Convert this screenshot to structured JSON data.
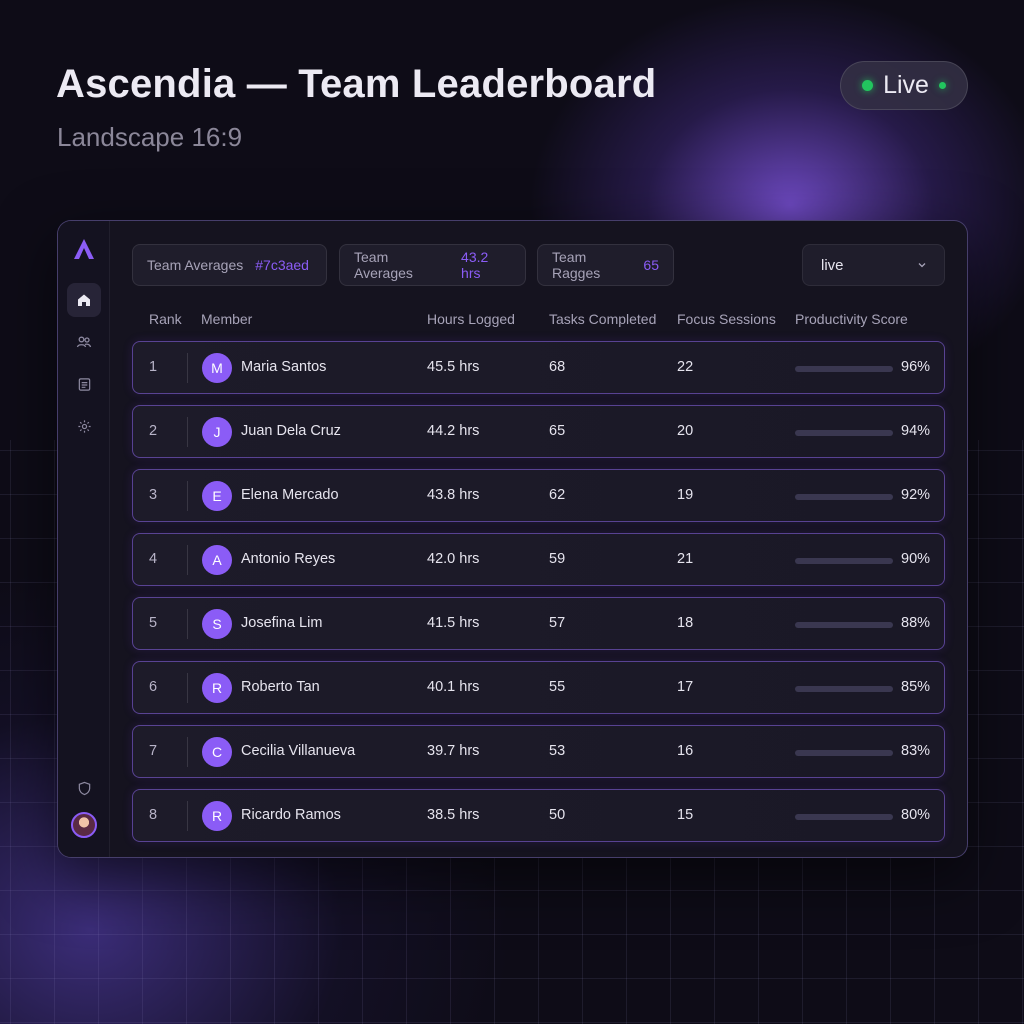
{
  "header": {
    "title": "Ascendia — Team Leaderboard",
    "subtitle": "Landscape 16:9",
    "live_label": "Live"
  },
  "colors": {
    "accent": "#8b5cf6",
    "live_dot": "#22c55e",
    "background": "#0e0c17"
  },
  "sidebar": {
    "logo": "ascendia-logo-icon",
    "items": [
      {
        "icon": "home-icon",
        "active": true
      },
      {
        "icon": "team-icon",
        "active": false
      },
      {
        "icon": "document-icon",
        "active": false
      },
      {
        "icon": "settings-icon",
        "active": false
      }
    ],
    "bottom": [
      {
        "icon": "shield-icon"
      },
      {
        "icon": "user-avatar"
      }
    ]
  },
  "chips": [
    {
      "label": "Team Averages",
      "value": "#7c3aed"
    },
    {
      "label": "Team Averages",
      "value": "43.2 hrs"
    },
    {
      "label": "Team Ragges",
      "value": "65"
    }
  ],
  "filter": {
    "selected": "live"
  },
  "table": {
    "columns": [
      "Rank",
      "Member",
      "Hours Logged",
      "Tasks Completed",
      "Focus Sessions",
      "Productivity Score"
    ],
    "rows": [
      {
        "rank": "1",
        "initial": "M",
        "name": "Maria Santos",
        "hours": "45.5 hrs",
        "tasks": "68",
        "focus": "22",
        "score": "96%",
        "score_value": 96
      },
      {
        "rank": "2",
        "initial": "J",
        "name": "Juan Dela Cruz",
        "hours": "44.2 hrs",
        "tasks": "65",
        "focus": "20",
        "score": "94%",
        "score_value": 94
      },
      {
        "rank": "3",
        "initial": "E",
        "name": "Elena Mercado",
        "hours": "43.8 hrs",
        "tasks": "62",
        "focus": "19",
        "score": "92%",
        "score_value": 92
      },
      {
        "rank": "4",
        "initial": "A",
        "name": "Antonio Reyes",
        "hours": "42.0 hrs",
        "tasks": "59",
        "focus": "21",
        "score": "90%",
        "score_value": 90
      },
      {
        "rank": "5",
        "initial": "S",
        "name": "Josefina Lim",
        "hours": "41.5 hrs",
        "tasks": "57",
        "focus": "18",
        "score": "88%",
        "score_value": 88
      },
      {
        "rank": "6",
        "initial": "R",
        "name": "Roberto Tan",
        "hours": "40.1 hrs",
        "tasks": "55",
        "focus": "17",
        "score": "85%",
        "score_value": 85
      },
      {
        "rank": "7",
        "initial": "C",
        "name": "Cecilia Villanueva",
        "hours": "39.7 hrs",
        "tasks": "53",
        "focus": "16",
        "score": "83%",
        "score_value": 83
      },
      {
        "rank": "8",
        "initial": "R",
        "name": "Ricardo Ramos",
        "hours": "38.5 hrs",
        "tasks": "50",
        "focus": "15",
        "score": "80%",
        "score_value": 80
      }
    ]
  }
}
